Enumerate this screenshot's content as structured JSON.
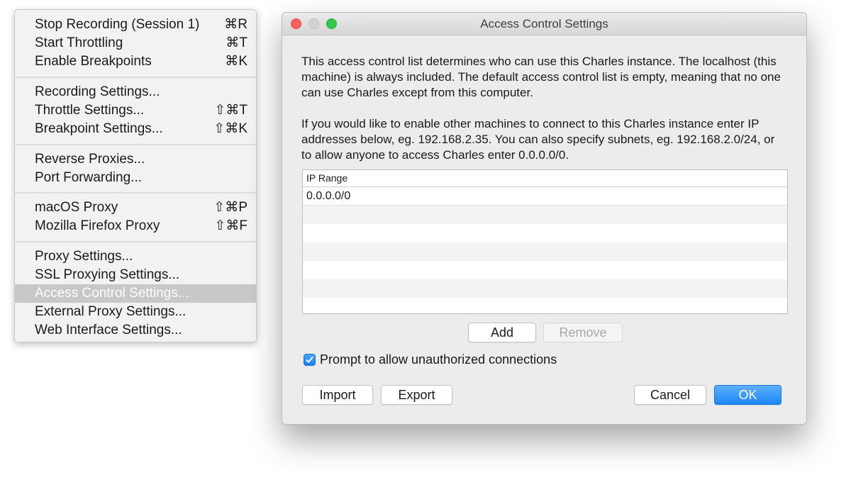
{
  "menu": {
    "items": [
      {
        "label": "Stop Recording (Session 1)",
        "shortcut": "⌘R"
      },
      {
        "label": "Start Throttling",
        "shortcut": "⌘T"
      },
      {
        "label": "Enable Breakpoints",
        "shortcut": "⌘K"
      },
      {
        "label": "Recording Settings...",
        "shortcut": ""
      },
      {
        "label": "Throttle Settings...",
        "shortcut": "⇧⌘T"
      },
      {
        "label": "Breakpoint Settings...",
        "shortcut": "⇧⌘K"
      },
      {
        "label": "Reverse Proxies...",
        "shortcut": ""
      },
      {
        "label": "Port Forwarding...",
        "shortcut": ""
      },
      {
        "label": "macOS Proxy",
        "shortcut": "⇧⌘P"
      },
      {
        "label": "Mozilla Firefox Proxy",
        "shortcut": "⇧⌘F"
      },
      {
        "label": "Proxy Settings...",
        "shortcut": ""
      },
      {
        "label": "SSL Proxying Settings...",
        "shortcut": ""
      },
      {
        "label": "Access Control Settings...",
        "shortcut": ""
      },
      {
        "label": "External Proxy Settings...",
        "shortcut": ""
      },
      {
        "label": "Web Interface Settings...",
        "shortcut": ""
      }
    ],
    "highlighted_item": "Access Control Settings..."
  },
  "dialog": {
    "title": "Access Control Settings",
    "description_1": "This access control list determines who can use this Charles instance. The localhost (this machine) is always included. The default access control list is empty, meaning that no one can use Charles except from this computer.",
    "description_2": "If you would like to enable other machines to connect to this Charles instance enter IP addresses below, eg. 192.168.2.35. You can also specify subnets, eg. 192.168.2.0/24, or to allow anyone to access Charles enter 0.0.0.0/0.",
    "table": {
      "column_header": "IP Range",
      "rows": [
        "0.0.0.0/0"
      ]
    },
    "add_button": "Add",
    "remove_button": "Remove",
    "checkbox_label": "Prompt to allow unauthorized connections",
    "checkbox_checked": true,
    "import_button": "Import",
    "export_button": "Export",
    "cancel_button": "Cancel",
    "ok_button": "OK"
  },
  "colors": {
    "accent": "#1c86f5",
    "close": "#fc615d",
    "maximize": "#34c84a"
  }
}
